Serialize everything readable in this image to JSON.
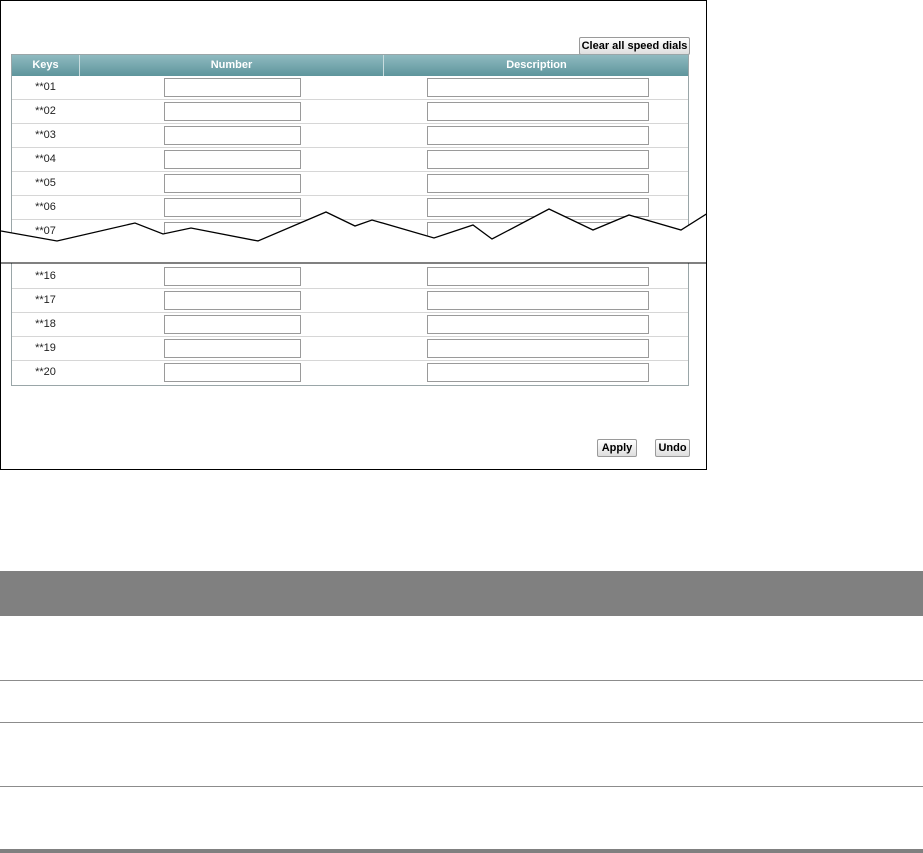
{
  "buttons": {
    "clear_all": "Clear all speed dials",
    "apply": "Apply",
    "undo": "Undo"
  },
  "table": {
    "columns": [
      "Keys",
      "Number",
      "Description"
    ],
    "rows_top": [
      {
        "key": "**01",
        "number": "",
        "description": ""
      },
      {
        "key": "**02",
        "number": "",
        "description": ""
      },
      {
        "key": "**03",
        "number": "",
        "description": ""
      },
      {
        "key": "**04",
        "number": "",
        "description": ""
      },
      {
        "key": "**05",
        "number": "",
        "description": ""
      },
      {
        "key": "**06",
        "number": "",
        "description": ""
      },
      {
        "key": "**07",
        "number": "",
        "description": ""
      }
    ],
    "rows_bottom": [
      {
        "key": "**16",
        "number": "",
        "description": ""
      },
      {
        "key": "**17",
        "number": "",
        "description": ""
      },
      {
        "key": "**18",
        "number": "",
        "description": ""
      },
      {
        "key": "**19",
        "number": "",
        "description": ""
      },
      {
        "key": "**20",
        "number": "",
        "description": ""
      }
    ]
  }
}
